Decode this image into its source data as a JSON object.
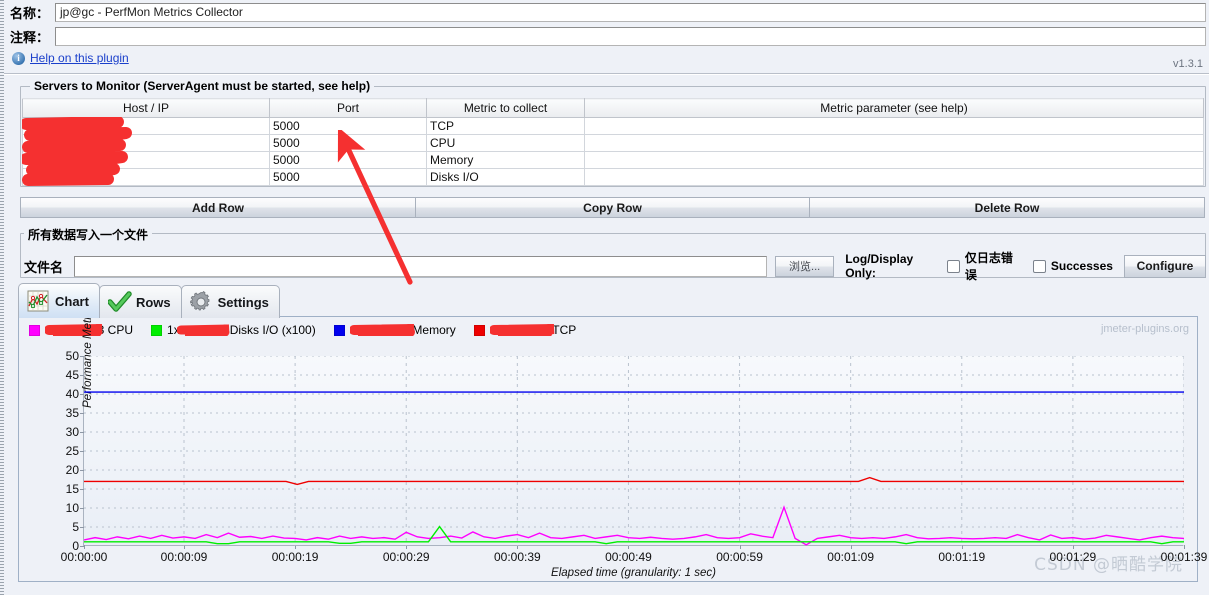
{
  "form": {
    "name_label": "名称：",
    "name_value": "jp@gc - PerfMon Metrics Collector",
    "comment_label": "注释：",
    "comment_value": "",
    "help_link": "Help on this plugin",
    "help_icon": "info-icon",
    "version": "v1.3.1"
  },
  "servers_group": {
    "title": "Servers to Monitor (ServerAgent must be started, see help)",
    "columns": [
      "Host / IP",
      "Port",
      "Metric to collect",
      "Metric parameter (see help)"
    ],
    "rows": [
      {
        "host": "",
        "host_redacted": true,
        "port": "5000",
        "metric": "TCP",
        "parameter": ""
      },
      {
        "host": "",
        "host_redacted": true,
        "port": "5000",
        "metric": "CPU",
        "parameter": ""
      },
      {
        "host": "",
        "host_redacted": true,
        "port": "5000",
        "metric": "Memory",
        "parameter": ""
      },
      {
        "host": "",
        "host_redacted": true,
        "port": "5000",
        "metric": "Disks I/O",
        "parameter": ""
      }
    ],
    "buttons": [
      "Add Row",
      "Copy Row",
      "Delete Row"
    ]
  },
  "file_group": {
    "title": "所有数据写入一个文件",
    "filename_label": "文件名",
    "filename_value": "",
    "browse_label": "浏览...",
    "log_display_label": "Log/Display Only:",
    "checkbox_errors_label": "仅日志错误",
    "checkbox_errors_checked": false,
    "checkbox_successes_label": "Successes",
    "checkbox_successes_checked": false,
    "configure_label": "Configure"
  },
  "tabs": [
    {
      "label": "Chart",
      "icon": "chart-icon",
      "active": true
    },
    {
      "label": "Rows",
      "icon": "checkmark-icon",
      "active": false
    },
    {
      "label": "Settings",
      "icon": "gear-icon",
      "active": false
    }
  ],
  "watermarks": {
    "plugin": "jmeter-plugins.org",
    "csdn": "CSDN @晒酷学院"
  },
  "annotation": {
    "type": "red-arrow",
    "color": "#f53030"
  },
  "chart_data": {
    "type": "line",
    "title": "",
    "xlabel": "Elapsed time (granularity: 1 sec)",
    "ylabel": "Performance Metrics",
    "ylim": [
      0,
      50
    ],
    "yticks": [
      0,
      5,
      10,
      15,
      20,
      25,
      30,
      35,
      40,
      45,
      50
    ],
    "xlim": [
      0,
      99
    ],
    "xticks": [
      0,
      9,
      19,
      29,
      39,
      49,
      59,
      69,
      79,
      89,
      99
    ],
    "xticklabels": [
      "00:00:00",
      "00:00:09",
      "00:00:19",
      "00:00:29",
      "00:00:39",
      "00:00:49",
      "00:00:59",
      "00:01:09",
      "00:01:19",
      "00:01:29",
      "00:01:39"
    ],
    "grid": true,
    "legend_position": "top-left",
    "series": [
      {
        "name": "CPU",
        "legend_label": "1xx.xx.x.x3 CPU",
        "legend_redacted": true,
        "color": "#ff00ff",
        "values": [
          1.6,
          2.2,
          1.7,
          2.4,
          1.9,
          2.6,
          2.0,
          2.8,
          2.1,
          2.4,
          2.0,
          3.0,
          2.2,
          3.4,
          2.3,
          2.5,
          2.0,
          2.6,
          2.1,
          2.0,
          1.6,
          2.2,
          1.8,
          2.6,
          2.0,
          2.4,
          2.0,
          2.2,
          1.8,
          3.6,
          2.4,
          2.0,
          2.2,
          2.6,
          2.1,
          3.7,
          2.4,
          2.0,
          2.6,
          3.0,
          2.2,
          3.4,
          2.2,
          2.0,
          2.4,
          2.8,
          2.0,
          2.4,
          2.8,
          2.2,
          2.0,
          2.3,
          2.0,
          1.8,
          2.0,
          2.4,
          3.0,
          2.2,
          2.0,
          2.2,
          3.2,
          2.6,
          2.2,
          10.2,
          2.0,
          0.3,
          2.0,
          2.4,
          2.8,
          2.2,
          2.0,
          2.2,
          2.0,
          2.4,
          3.0,
          2.2,
          1.9,
          2.0,
          2.2,
          2.0,
          1.9,
          2.0,
          2.2,
          2.0,
          3.0,
          2.2,
          1.6,
          2.9,
          2.0,
          2.2,
          1.8,
          2.1,
          2.8,
          2.4,
          2.0,
          1.6,
          2.2,
          2.6,
          2.2,
          2.0
        ]
      },
      {
        "name": "Disks I/O (x100)",
        "legend_label": "1xx.xx.x.x3 Disks I/O (x100)",
        "legend_redacted": true,
        "color": "#00ee00",
        "values": [
          1.1,
          1.1,
          1.1,
          1.1,
          1.1,
          1.1,
          1.1,
          1.1,
          1.1,
          1.1,
          1.1,
          1.1,
          0.6,
          0.6,
          1.1,
          1.1,
          1.1,
          1.1,
          1.1,
          1.1,
          1.1,
          1.1,
          1.1,
          0.7,
          0.7,
          1.1,
          1.1,
          1.1,
          1.1,
          1.1,
          1.1,
          1.1,
          5.1,
          1.1,
          1.1,
          1.1,
          1.1,
          1.1,
          1.1,
          1.1,
          1.1,
          1.1,
          1.1,
          1.1,
          1.1,
          1.1,
          1.1,
          0.6,
          1.1,
          1.1,
          1.1,
          1.1,
          1.1,
          1.1,
          1.1,
          1.1,
          1.1,
          1.1,
          1.1,
          1.1,
          1.1,
          1.1,
          1.1,
          1.1,
          1.1,
          1.1,
          1.1,
          1.1,
          1.1,
          1.1,
          1.1,
          1.1,
          1.1,
          1.1,
          0.6,
          1.1,
          1.1,
          1.1,
          1.1,
          1.1,
          1.1,
          1.1,
          1.1,
          1.1,
          1.1,
          1.1,
          1.1,
          1.1,
          1.1,
          1.1,
          1.1,
          1.1,
          1.1,
          1.1,
          1.1,
          1.1,
          1.1,
          0.6,
          1.1,
          1.1
        ]
      },
      {
        "name": "Memory",
        "legend_label": "1xx.xx.x.x3 Memory",
        "legend_redacted": true,
        "color": "#0000ee",
        "values": [
          40.5,
          40.5,
          40.5,
          40.5,
          40.5,
          40.5,
          40.5,
          40.5,
          40.5,
          40.5,
          40.5,
          40.5,
          40.5,
          40.5,
          40.5,
          40.5,
          40.5,
          40.5,
          40.5,
          40.5,
          40.5,
          40.5,
          40.5,
          40.5,
          40.5,
          40.5,
          40.5,
          40.5,
          40.5,
          40.5,
          40.5,
          40.5,
          40.5,
          40.5,
          40.5,
          40.5,
          40.5,
          40.5,
          40.5,
          40.5,
          40.5,
          40.5,
          40.5,
          40.5,
          40.5,
          40.5,
          40.5,
          40.5,
          40.5,
          40.5,
          40.5,
          40.5,
          40.5,
          40.5,
          40.5,
          40.5,
          40.5,
          40.5,
          40.5,
          40.5,
          40.5,
          40.5,
          40.5,
          40.5,
          40.5,
          40.5,
          40.5,
          40.5,
          40.5,
          40.5,
          40.5,
          40.5,
          40.5,
          40.5,
          40.5,
          40.5,
          40.5,
          40.5,
          40.5,
          40.5,
          40.5,
          40.5,
          40.5,
          40.5,
          40.5,
          40.5,
          40.5,
          40.5,
          40.5,
          40.5,
          40.5,
          40.5,
          40.5,
          40.5,
          40.5,
          40.5,
          40.5,
          40.5,
          40.5,
          40.5
        ]
      },
      {
        "name": "TCP",
        "legend_label": "1xx.xx.x.x3 TCP",
        "legend_redacted": true,
        "color": "#ee0000",
        "values": [
          17,
          17,
          17,
          17,
          17,
          17,
          17,
          17,
          17,
          17,
          17,
          17,
          17,
          17,
          17,
          17,
          17,
          17,
          17,
          16.2,
          17,
          17,
          17,
          17,
          17,
          17,
          17,
          17,
          17,
          17,
          17,
          17,
          17,
          17,
          17,
          17,
          17,
          17,
          17,
          17,
          17,
          17,
          17,
          17,
          17,
          17,
          17,
          17,
          17,
          17,
          17,
          17,
          17,
          17,
          17,
          17,
          17,
          17,
          17,
          17,
          17,
          17,
          17,
          17,
          17,
          17,
          17,
          17,
          17,
          17,
          18,
          17,
          17,
          17,
          17,
          17,
          17,
          17,
          17,
          17,
          17,
          17,
          17,
          17,
          17,
          17,
          17,
          17,
          17,
          17,
          17,
          17,
          17,
          17,
          17,
          17,
          17,
          17,
          17
        ]
      }
    ]
  }
}
